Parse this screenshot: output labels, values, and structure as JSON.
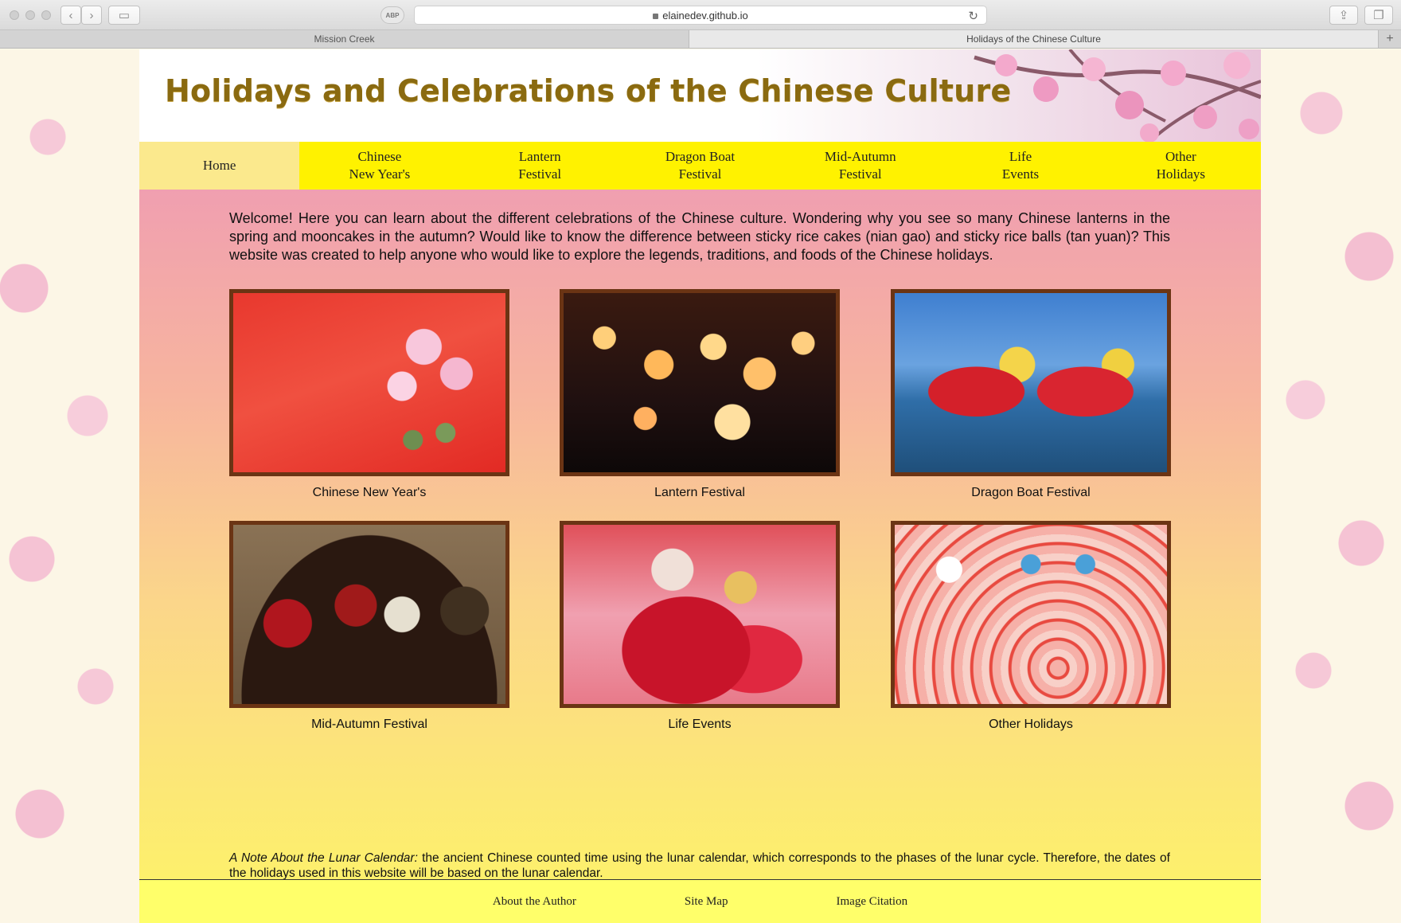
{
  "browser": {
    "url": "elainedev.github.io",
    "abp_label": "ABP",
    "tabs": [
      {
        "label": "Mission Creek",
        "active": false
      },
      {
        "label": "Holidays of the Chinese Culture",
        "active": true
      }
    ],
    "new_tab_label": "+"
  },
  "site": {
    "title": "Holidays and Celebrations of the Chinese Culture",
    "nav": [
      {
        "line1": "Home",
        "line2": "",
        "active": true
      },
      {
        "line1": "Chinese",
        "line2": "New Year's",
        "active": false
      },
      {
        "line1": "Lantern",
        "line2": "Festival",
        "active": false
      },
      {
        "line1": "Dragon Boat",
        "line2": "Festival",
        "active": false
      },
      {
        "line1": "Mid-Autumn",
        "line2": "Festival",
        "active": false
      },
      {
        "line1": "Life",
        "line2": "Events",
        "active": false
      },
      {
        "line1": "Other",
        "line2": "Holidays",
        "active": false
      }
    ],
    "welcome": "Welcome! Here you can learn about the different celebrations of the Chinese culture. Wondering why you see so many Chinese lanterns in the spring and mooncakes in the autumn? Would like to know the difference between sticky rice cakes (nian gao) and sticky rice balls (tan yuan)? This website was created to help anyone who would like to explore the legends, traditions, and foods of the Chinese holidays.",
    "cards": [
      {
        "caption": "Chinese New Year's"
      },
      {
        "caption": "Lantern Festival"
      },
      {
        "caption": "Dragon Boat Festival"
      },
      {
        "caption": "Mid-Autumn Festival"
      },
      {
        "caption": "Life Events"
      },
      {
        "caption": "Other Holidays"
      }
    ],
    "note_label": "A Note About the Lunar Calendar:",
    "note_text": " the ancient Chinese counted time using the lunar calendar, which corresponds to the phases of the lunar cycle. Therefore, the dates of the holidays used in this website will be based on the lunar calendar.",
    "footer": [
      {
        "label": "About the Author"
      },
      {
        "label": "Site Map"
      },
      {
        "label": "Image Citation"
      }
    ]
  },
  "colors": {
    "nav_bg": "#fff200",
    "nav_active": "#fbe98d",
    "frame": "#6b3414",
    "title": "#8a6a10",
    "footer_bg": "#ffff6a"
  }
}
